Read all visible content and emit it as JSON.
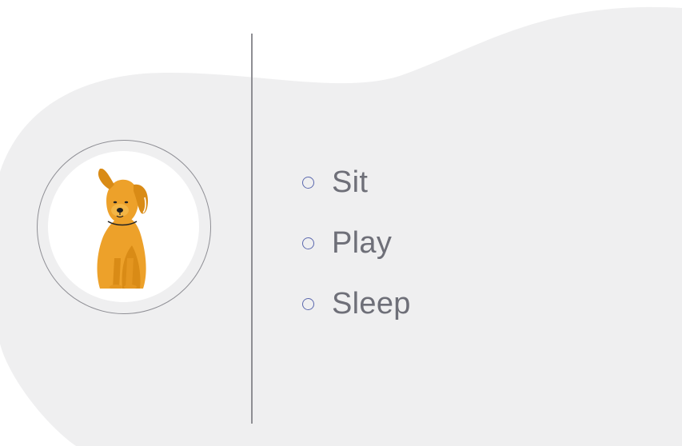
{
  "colors": {
    "background_blob": "#efeff0",
    "divider": "#8e8e93",
    "radio_outline": "#5a67ad",
    "option_text": "#6e6f78",
    "dog_fur": "#eda12a"
  },
  "avatar": {
    "icon": "dog-icon"
  },
  "options": [
    {
      "label": "Sit",
      "selected": false
    },
    {
      "label": "Play",
      "selected": false
    },
    {
      "label": "Sleep",
      "selected": false
    }
  ]
}
